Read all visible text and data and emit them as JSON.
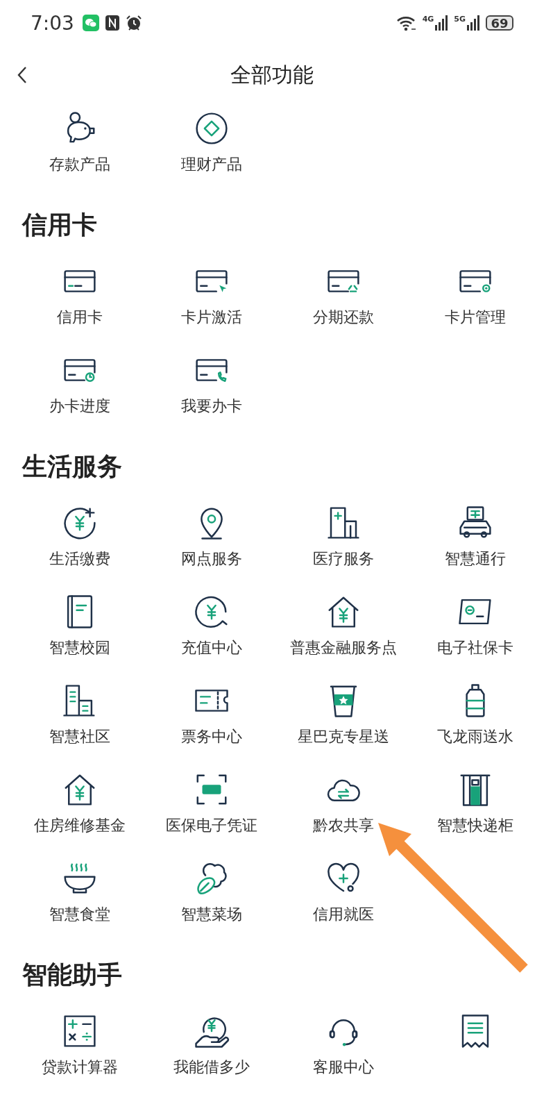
{
  "status_bar": {
    "time": "7:03",
    "network_1": "4G",
    "network_2": "5G",
    "battery": "69"
  },
  "header": {
    "title": "全部功能"
  },
  "sections": [
    {
      "items": [
        {
          "kind": "piggy",
          "label": "存款产品"
        },
        {
          "kind": "diamond",
          "label": "理财产品"
        }
      ]
    },
    {
      "title": "信用卡",
      "items": [
        {
          "kind": "card",
          "label": "信用卡"
        },
        {
          "kind": "card-cursor",
          "label": "卡片激活"
        },
        {
          "kind": "card-split",
          "label": "分期还款"
        },
        {
          "kind": "card-gear",
          "label": "卡片管理"
        },
        {
          "kind": "card-clock",
          "label": "办卡进度"
        },
        {
          "kind": "card-phone",
          "label": "我要办卡"
        }
      ]
    },
    {
      "title": "生活服务",
      "items": [
        {
          "kind": "yuan-plus",
          "label": "生活缴费"
        },
        {
          "kind": "location",
          "label": "网点服务"
        },
        {
          "kind": "hospital",
          "label": "医疗服务"
        },
        {
          "kind": "car",
          "label": "智慧通行"
        },
        {
          "kind": "document",
          "label": "智慧校园"
        },
        {
          "kind": "yuan-chat",
          "label": "充值中心"
        },
        {
          "kind": "house-yuan",
          "label": "普惠金融服务点"
        },
        {
          "kind": "id-card",
          "label": "电子社保卡"
        },
        {
          "kind": "building",
          "label": "智慧社区"
        },
        {
          "kind": "ticket",
          "label": "票务中心"
        },
        {
          "kind": "cup",
          "label": "星巴克专星送"
        },
        {
          "kind": "bottle",
          "label": "飞龙雨送水"
        },
        {
          "kind": "house-yuan",
          "label": "住房维修基金"
        },
        {
          "kind": "scan",
          "label": "医保电子凭证"
        },
        {
          "kind": "cloud",
          "label": "黔农共享"
        },
        {
          "kind": "locker",
          "label": "智慧快递柜"
        },
        {
          "kind": "bowl",
          "label": "智慧食堂"
        },
        {
          "kind": "vegetable",
          "label": "智慧菜场"
        },
        {
          "kind": "heart",
          "label": "信用就医"
        }
      ]
    },
    {
      "title": "智能助手",
      "items": [
        {
          "kind": "calculator",
          "label": "贷款计算器"
        },
        {
          "kind": "hand-yuan",
          "label": "我能借多少"
        },
        {
          "kind": "headset",
          "label": "客服中心"
        },
        {
          "kind": "receipt"
        }
      ]
    }
  ],
  "annotation": {
    "kind": "arrow"
  }
}
